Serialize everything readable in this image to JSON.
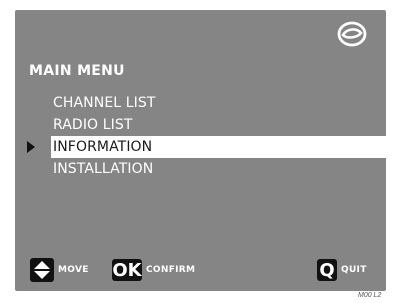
{
  "menu": {
    "title": "MAIN MENU",
    "items": [
      {
        "label": "CHANNEL LIST"
      },
      {
        "label": "RADIO LIST"
      },
      {
        "label": "INFORMATION",
        "selected": true
      },
      {
        "label": "INSTALLATION"
      }
    ]
  },
  "footer": {
    "move": {
      "key": "",
      "label": "MOVE"
    },
    "confirm": {
      "key": "OK",
      "label": "CONFIRM"
    },
    "quit": {
      "key": "Q",
      "label": "QUIT"
    }
  },
  "corner_code": "M00 L2",
  "icons": {
    "logo": "brand-ring-icon",
    "move": "up-down-arrows-icon",
    "pointer": "selection-pointer-icon"
  },
  "colors": {
    "screen_bg": "#858585",
    "text": "#ffffff",
    "selected_bg": "#ffffff",
    "selected_text": "#1a1a1a",
    "key_bg": "#111111"
  }
}
